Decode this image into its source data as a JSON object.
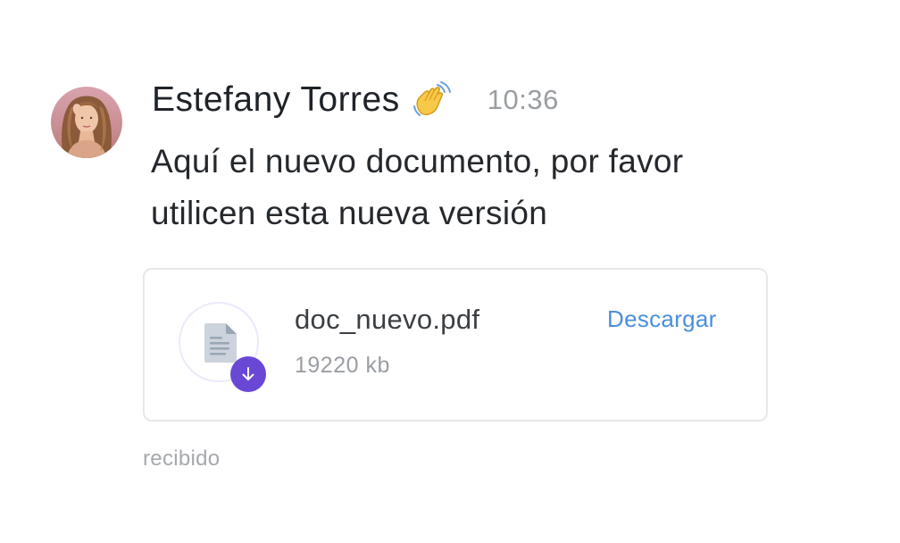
{
  "message": {
    "sender_name": "Estefany Torres",
    "emoji": "👋",
    "timestamp": "10:36",
    "text": "Aquí el nuevo documento, por favor utilicen esta nueva versión",
    "status": "recibido"
  },
  "attachment": {
    "file_name": "doc_nuevo.pdf",
    "file_size": "19220 kb",
    "download_label": "Descargar",
    "icons": {
      "file": "document-icon",
      "badge": "download-arrow-icon"
    }
  },
  "colors": {
    "accent_purple": "#6a48d6",
    "link_blue": "#4a8fdc",
    "muted_gray": "#9a9ea3",
    "text_dark": "#1f2328",
    "card_border": "#e6e8eb"
  }
}
